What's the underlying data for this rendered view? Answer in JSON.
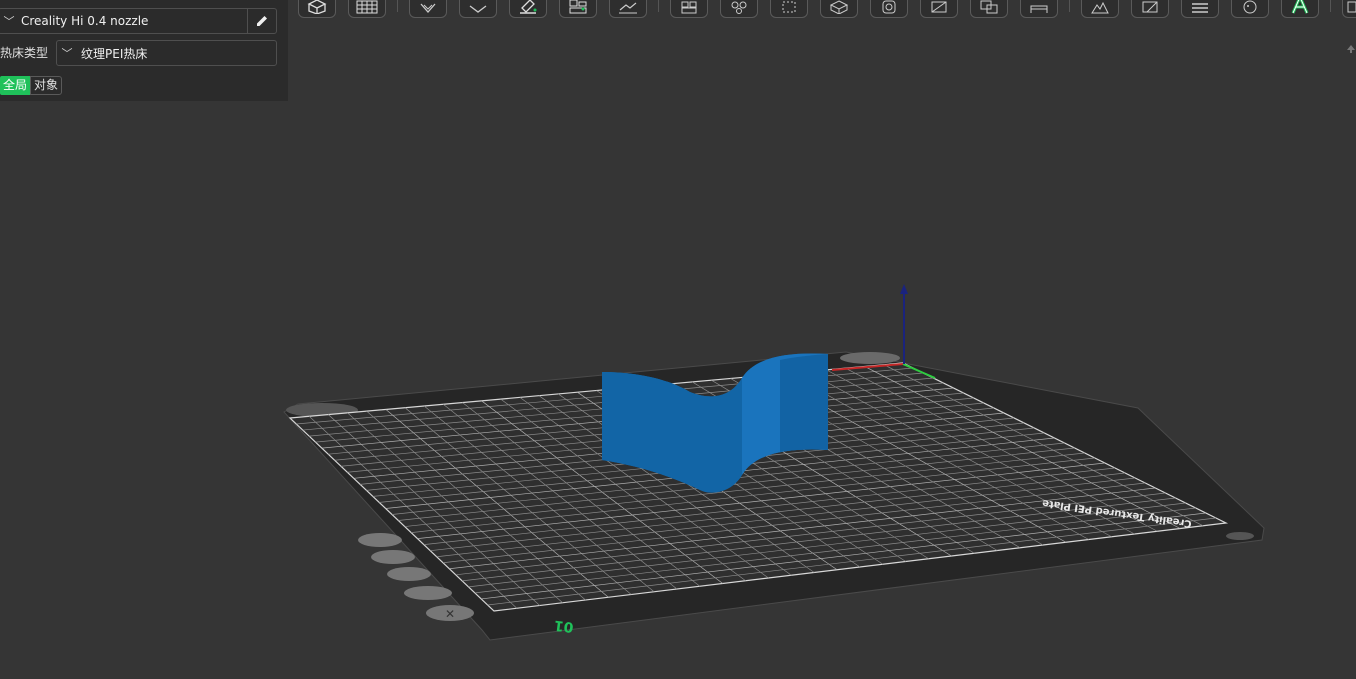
{
  "left_panel": {
    "printer": {
      "value": "Creality Hi 0.4 nozzle",
      "chevron_icon": "chevron-down-icon",
      "edit_icon": "pencil-icon"
    },
    "bed_type": {
      "label": "热床类型",
      "value": "纹理PEI热床",
      "chevron_icon": "chevron-down-icon"
    },
    "tabs": [
      {
        "label": "全局",
        "active": true
      },
      {
        "label": "对象",
        "active": false
      }
    ]
  },
  "toolbar": {
    "buttons": [
      {
        "icon": "add-cube-icon"
      },
      {
        "icon": "plate-grid-icon"
      },
      {
        "icon": "orient-icon"
      },
      {
        "icon": "arrange-icon"
      },
      {
        "icon": "paint-icon"
      },
      {
        "icon": "split-icon"
      },
      {
        "icon": "lay-flat-icon"
      },
      {
        "icon": "split-objects-icon"
      },
      {
        "icon": "split-parts-icon"
      },
      {
        "icon": "scale-icon"
      },
      {
        "icon": "rotate-icon"
      },
      {
        "icon": "cut-icon"
      },
      {
        "icon": "measure-icon"
      },
      {
        "icon": "boolean-icon"
      },
      {
        "icon": "support-paint-icon"
      },
      {
        "icon": "seam-paint-icon"
      },
      {
        "icon": "variable-layer-icon"
      },
      {
        "icon": "emboss-text-icon"
      },
      {
        "icon": "more-icon"
      }
    ],
    "accent": "#1fc15a"
  },
  "viewport": {
    "plate_number": "01",
    "plate_name": "Creality Textured PEI Plate",
    "model_color": "#1369ad",
    "axis_colors": {
      "x": "#c62828",
      "y": "#2ecc40",
      "z": "#1a237e"
    }
  }
}
